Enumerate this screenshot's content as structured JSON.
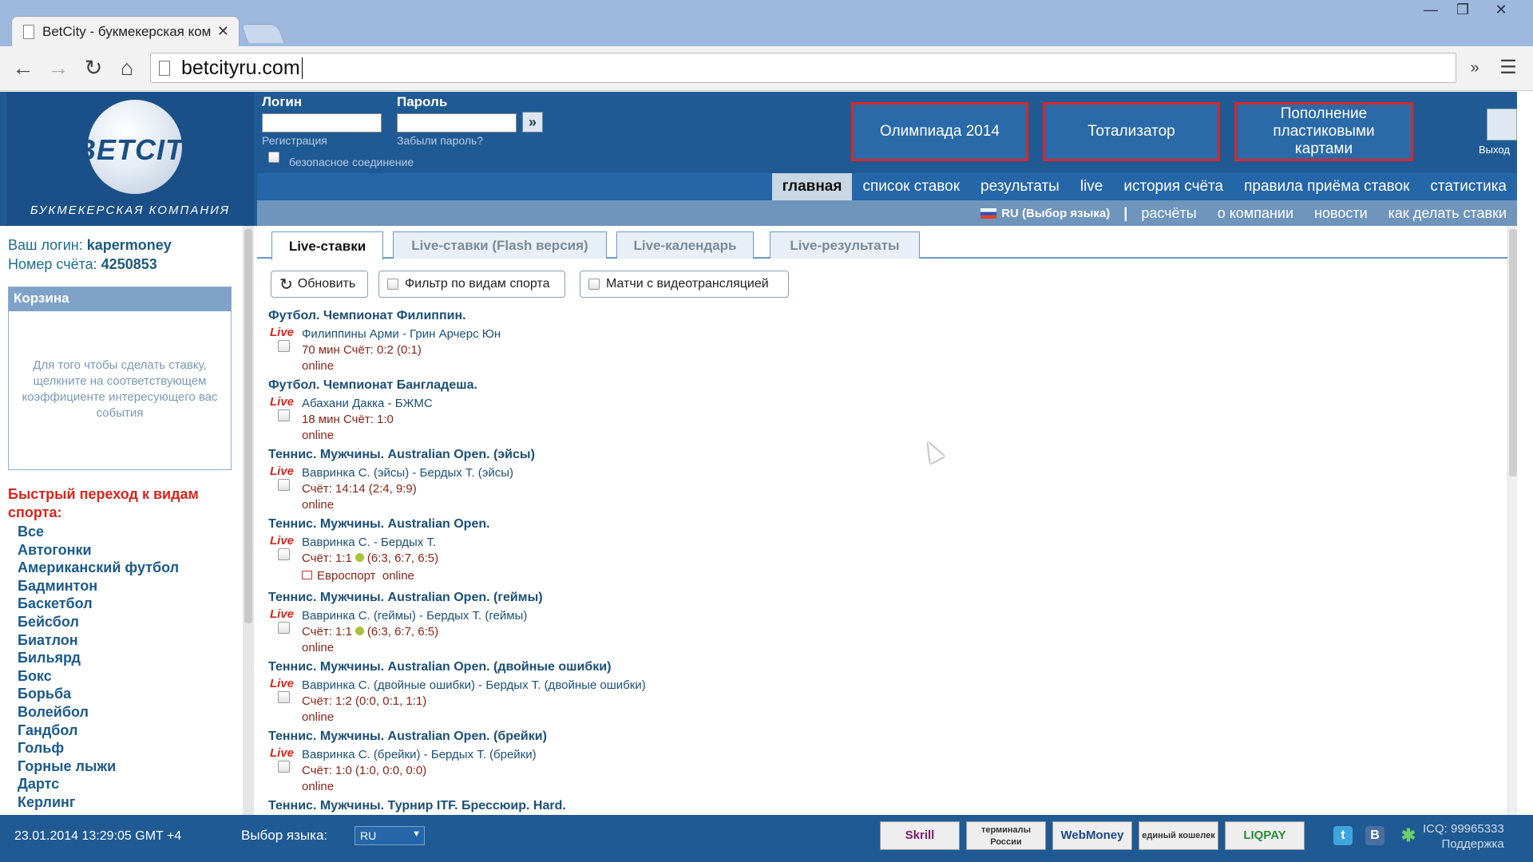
{
  "browser": {
    "tab_title": "BetCity - букмекерская ком",
    "url": "betcityru.com",
    "overflow": "»",
    "menu_icon": "hamburger-menu-icon"
  },
  "header": {
    "logo_text": "BETCITY",
    "logo_tagline": "БУКМЕКЕРСКАЯ КОМПАНИЯ",
    "login_label": "Логин",
    "password_label": "Пароль",
    "register": "Регистрация",
    "forgot": "Забыли пароль?",
    "secure": "безопасное соединение",
    "go": "»",
    "promo1": "Олимпиада 2014",
    "promo2": "Тотализатор",
    "promo3": "Пополнение пластиковыми картами",
    "exit": "Выход"
  },
  "mainnav": [
    "главная",
    "список ставок",
    "результаты",
    "live",
    "история счёта",
    "правила приёма ставок",
    "статистика"
  ],
  "subnav": {
    "lang": "RU (Выбор языка)",
    "sep": "|",
    "items": [
      "расчёты",
      "о компании",
      "новости",
      "как делать ставки"
    ]
  },
  "account": {
    "login_label": "Ваш логин:",
    "login_value": "kapermoney",
    "number_label": "Номер счёта:",
    "number_value": "4250853"
  },
  "cart": {
    "title": "Корзина",
    "hint": "Для того чтобы сделать ставку, щелкните на соответствующем коэффициенте интересующего вас события"
  },
  "quick": {
    "title": "Быстрый переход к видам спорта:",
    "sports": [
      "Все",
      "Автогонки",
      "Американский футбол",
      "Бадминтон",
      "Баскетбол",
      "Бейсбол",
      "Биатлон",
      "Бильярд",
      "Бокс",
      "Борьба",
      "Волейбол",
      "Гандбол",
      "Гольф",
      "Горные лыжи",
      "Дартс",
      "Керлинг"
    ]
  },
  "tabs": [
    "Live-ставки",
    "Live-ставки (Flash версия)",
    "Live-календарь",
    "Live-результаты"
  ],
  "filters": {
    "refresh": "Обновить",
    "by_sport": "Фильтр по видам спорта",
    "video": "Матчи с видеотрансляцией"
  },
  "live_label": "Live",
  "events": [
    {
      "title": "Футбол. Чемпионат Филиппин.",
      "match": "Филиппины Арми - Грин Арчерс Юн",
      "score": "70 мин Счёт: 0:2 (0:1)",
      "online": "online"
    },
    {
      "title": "Футбол. Чемпионат Бангладеша.",
      "match": "Абахани Дакка - БЖМС",
      "score": "18 мин Счёт: 1:0",
      "online": "online"
    },
    {
      "title": "Теннис. Мужчины. Australian Open. (эйсы)",
      "match": "Вавринка С. (эйсы) - Бердых Т. (эйсы)",
      "score": "Счёт: 14:14 (2:4, 9:9)",
      "online": "online"
    },
    {
      "title": "Теннис. Мужчины. Australian Open.",
      "match": "Вавринка С. - Бердых Т.",
      "score_a": "Счёт: 1:1",
      "score_b": "(6:3, 6:7, 6:5)",
      "tv": "Евроспорт",
      "online": "online"
    },
    {
      "title": "Теннис. Мужчины. Australian Open. (геймы)",
      "match": "Вавринка С. (геймы) - Бердых Т. (геймы)",
      "score_a": "Счёт: 1:1",
      "score_b": "(6:3, 6:7, 6:5)",
      "online": "online"
    },
    {
      "title": "Теннис. Мужчины. Australian Open. (двойные ошибки)",
      "match": "Вавринка С. (двойные ошибки) - Бердых Т. (двойные ошибки)",
      "score": "Счёт: 1:2 (0:0, 0:1, 1:1)",
      "online": "online"
    },
    {
      "title": "Теннис. Мужчины. Australian Open. (брейки)",
      "match": "Вавринка С. (брейки) - Бердых Т. (брейки)",
      "score": "Счёт: 1:0 (1:0, 0:0, 0:0)",
      "online": "online"
    },
    {
      "title": "Теннис. Мужчины. Турнир ITF. Брессюир. Hard."
    }
  ],
  "footer": {
    "datetime": "23.01.2014 13:29:05 GMT +4",
    "lang_label": "Выбор языка:",
    "lang_value": "RU",
    "payments": [
      "Skrill",
      "терминалы России",
      "WebMoney",
      "единый кошелек",
      "LIQPAY"
    ],
    "icq": "ICQ: 99965333",
    "support": "Поддержка"
  },
  "colors": {
    "header": "#1f5a94",
    "nav": "#2466a8",
    "subnav": "#6f95bd",
    "live": "#d6261d",
    "promo_border": "#d8262b"
  }
}
